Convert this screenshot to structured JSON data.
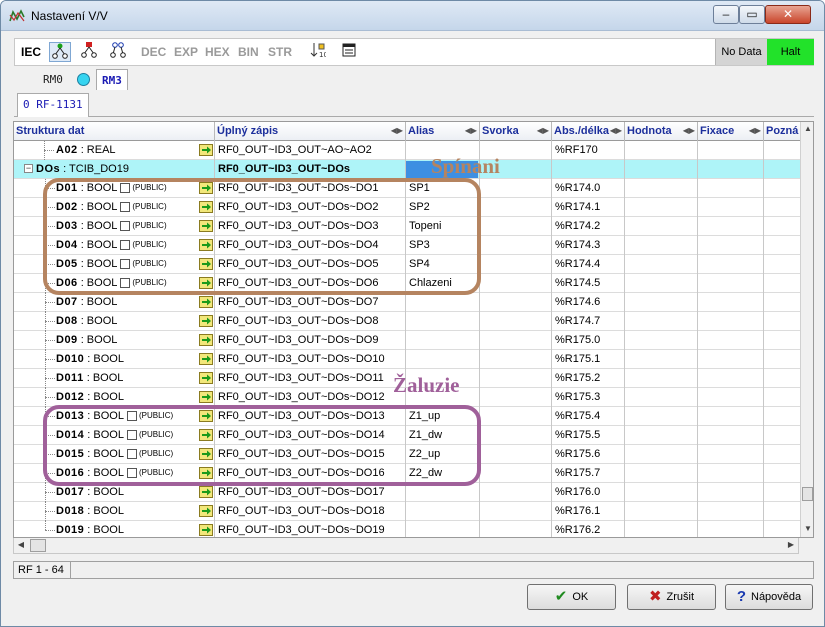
{
  "window": {
    "title": "Nastavení V/V"
  },
  "toolbar": {
    "iec": "IEC",
    "formats": [
      "DEC",
      "EXP",
      "HEX",
      "BIN",
      "STR"
    ],
    "status_nodata": "No Data",
    "status_halt": "Halt"
  },
  "tabs": {
    "rm0": "RM0",
    "rm3": "RM3",
    "rf": "0 RF-1131"
  },
  "columns": {
    "struktura": "Struktura dat",
    "zapis": "Úplný zápis",
    "alias": "Alias",
    "svorka": "Svorka",
    "abs": "Abs./délka",
    "hodnota": "Hodnota",
    "fixace": "Fixace",
    "pozna": "Pozná"
  },
  "rows": [
    {
      "name": "A02",
      "type": ": REAL",
      "public": "",
      "zapis": "RF0_OUT~ID3_OUT~AO~AO2",
      "alias": "",
      "abs": "%RF170"
    },
    {
      "name": "DOs",
      "type": ": TCIB_DO19",
      "public": "",
      "zapis": "RF0_OUT~ID3_OUT~DOs",
      "alias": "",
      "abs": ""
    },
    {
      "name": "D01",
      "type": ": BOOL",
      "public": "(PUBLIC)",
      "zapis": "RF0_OUT~ID3_OUT~DOs~DO1",
      "alias": "SP1",
      "abs": "%R174.0"
    },
    {
      "name": "D02",
      "type": ": BOOL",
      "public": "(PUBLIC)",
      "zapis": "RF0_OUT~ID3_OUT~DOs~DO2",
      "alias": "SP2",
      "abs": "%R174.1"
    },
    {
      "name": "D03",
      "type": ": BOOL",
      "public": "(PUBLIC)",
      "zapis": "RF0_OUT~ID3_OUT~DOs~DO3",
      "alias": "Topeni",
      "abs": "%R174.2"
    },
    {
      "name": "D04",
      "type": ": BOOL",
      "public": "(PUBLIC)",
      "zapis": "RF0_OUT~ID3_OUT~DOs~DO4",
      "alias": "SP3",
      "abs": "%R174.3"
    },
    {
      "name": "D05",
      "type": ": BOOL",
      "public": "(PUBLIC)",
      "zapis": "RF0_OUT~ID3_OUT~DOs~DO5",
      "alias": "SP4",
      "abs": "%R174.4"
    },
    {
      "name": "D06",
      "type": ": BOOL",
      "public": "(PUBLIC)",
      "zapis": "RF0_OUT~ID3_OUT~DOs~DO6",
      "alias": "Chlazeni",
      "abs": "%R174.5"
    },
    {
      "name": "D07",
      "type": ": BOOL",
      "public": "",
      "zapis": "RF0_OUT~ID3_OUT~DOs~DO7",
      "alias": "",
      "abs": "%R174.6"
    },
    {
      "name": "D08",
      "type": ": BOOL",
      "public": "",
      "zapis": "RF0_OUT~ID3_OUT~DOs~DO8",
      "alias": "",
      "abs": "%R174.7"
    },
    {
      "name": "D09",
      "type": ": BOOL",
      "public": "",
      "zapis": "RF0_OUT~ID3_OUT~DOs~DO9",
      "alias": "",
      "abs": "%R175.0"
    },
    {
      "name": "D010",
      "type": ": BOOL",
      "public": "",
      "zapis": "RF0_OUT~ID3_OUT~DOs~DO10",
      "alias": "",
      "abs": "%R175.1"
    },
    {
      "name": "D011",
      "type": ": BOOL",
      "public": "",
      "zapis": "RF0_OUT~ID3_OUT~DOs~DO11",
      "alias": "",
      "abs": "%R175.2"
    },
    {
      "name": "D012",
      "type": ": BOOL",
      "public": "",
      "zapis": "RF0_OUT~ID3_OUT~DOs~DO12",
      "alias": "",
      "abs": "%R175.3"
    },
    {
      "name": "D013",
      "type": ": BOOL",
      "public": "(PUBLIC)",
      "zapis": "RF0_OUT~ID3_OUT~DOs~DO13",
      "alias": "Z1_up",
      "abs": "%R175.4"
    },
    {
      "name": "D014",
      "type": ": BOOL",
      "public": "(PUBLIC)",
      "zapis": "RF0_OUT~ID3_OUT~DOs~DO14",
      "alias": "Z1_dw",
      "abs": "%R175.5"
    },
    {
      "name": "D015",
      "type": ": BOOL",
      "public": "(PUBLIC)",
      "zapis": "RF0_OUT~ID3_OUT~DOs~DO15",
      "alias": "Z2_up",
      "abs": "%R175.6"
    },
    {
      "name": "D016",
      "type": ": BOOL",
      "public": "(PUBLIC)",
      "zapis": "RF0_OUT~ID3_OUT~DOs~DO16",
      "alias": "Z2_dw",
      "abs": "%R175.7"
    },
    {
      "name": "D017",
      "type": ": BOOL",
      "public": "",
      "zapis": "RF0_OUT~ID3_OUT~DOs~DO17",
      "alias": "",
      "abs": "%R176.0"
    },
    {
      "name": "D018",
      "type": ": BOOL",
      "public": "",
      "zapis": "RF0_OUT~ID3_OUT~DOs~DO18",
      "alias": "",
      "abs": "%R176.1"
    },
    {
      "name": "D019",
      "type": ": BOOL",
      "public": "",
      "zapis": "RF0_OUT~ID3_OUT~DOs~DO19",
      "alias": "",
      "abs": "%R176.2"
    }
  ],
  "annotations": {
    "spinani": "Spínani",
    "zaluzie": "Žaluzie"
  },
  "statusbar": {
    "text": "RF 1 - 64"
  },
  "buttons": {
    "ok": "OK",
    "cancel": "Zrušit",
    "help": "Nápověda"
  },
  "colors": {
    "halt": "#22e22a",
    "selected_row": "#aef4f8",
    "header_text": "#1c2f9c",
    "spinani_box": "#b58460",
    "zaluzie_box": "#a0609a"
  }
}
